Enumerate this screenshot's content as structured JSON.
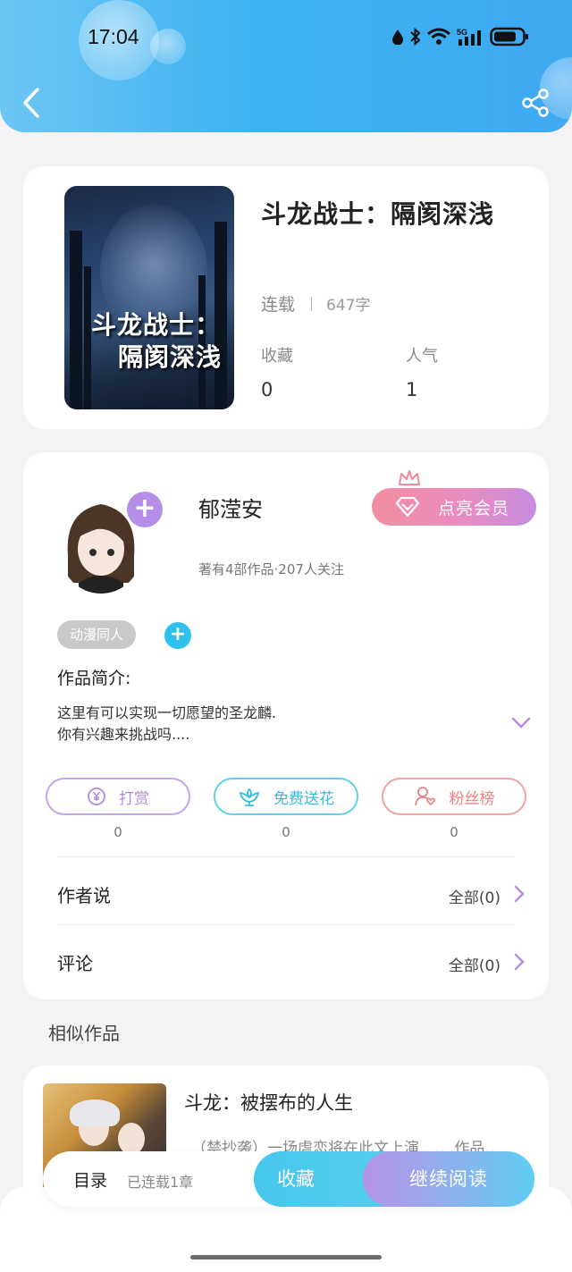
{
  "status_bar": {
    "time": "17:04",
    "network": "5G"
  },
  "book": {
    "title": "斗龙战士：隔阂深浅",
    "cover_text_line1": "斗龙战士：",
    "cover_text_line2": "隔阂深浅",
    "status": "连载",
    "word_count": "647字",
    "favorites_label": "收藏",
    "favorites_value": "0",
    "popularity_label": "人气",
    "popularity_value": "1"
  },
  "author": {
    "name": "郁滢安",
    "meta": "著有4部作品·207人关注",
    "vip_label": "点亮会员",
    "tag": "动漫同人",
    "intro_label": "作品简介:",
    "intro_text": "这里有可以实现一切愿望的圣龙麟.\n你有兴趣来挑战吗...."
  },
  "actions": [
    {
      "label": "打赏",
      "count": "0"
    },
    {
      "label": "免费送花",
      "count": "0"
    },
    {
      "label": "粉丝榜",
      "count": "0"
    }
  ],
  "rows": {
    "author_says": {
      "label": "作者说",
      "all": "全部(0)"
    },
    "comments": {
      "label": "评论",
      "all": "全部(0)"
    }
  },
  "similar": {
    "heading": "相似作品",
    "items": [
      {
        "title": "斗龙：被摆布的人生",
        "desc": "（禁抄袭）一场虐恋将在此文上演…… 作品…"
      }
    ]
  },
  "bottom_bar": {
    "toc_label": "目录",
    "toc_sub": "已连载1章",
    "favorite_button": "收藏",
    "continue_button": "继续阅读"
  },
  "colors": {
    "header": "#3db2f0",
    "accent_purple": "#b58ee8",
    "accent_cyan": "#2ec1ee",
    "accent_pink": "#ea7f82"
  }
}
